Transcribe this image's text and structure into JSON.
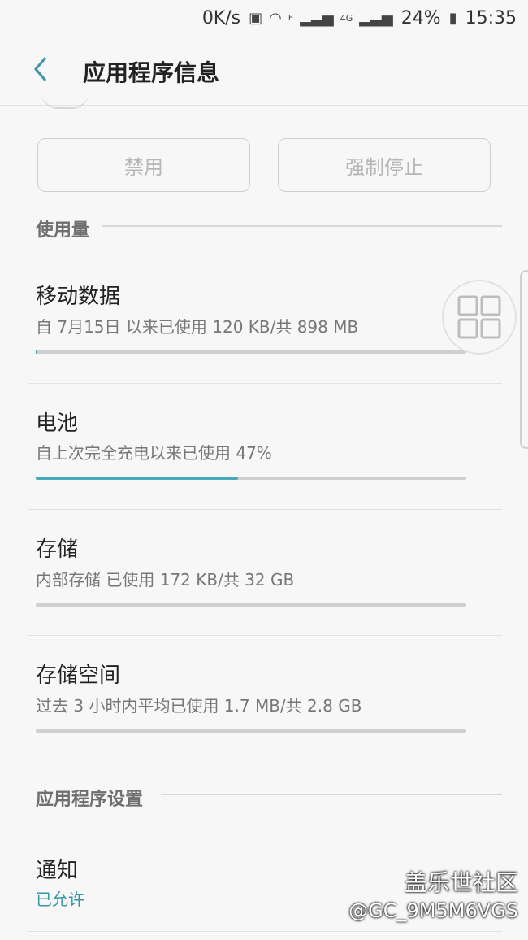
{
  "status_bar": {
    "speed": "0K/s",
    "network": "4G",
    "network_small": "E",
    "battery": "24%",
    "time": "15:35"
  },
  "header": {
    "title": "应用程序信息"
  },
  "buttons": {
    "disable": "禁用",
    "force_stop": "强制停止"
  },
  "sections": {
    "usage": "使用量",
    "app_settings": "应用程序设置"
  },
  "rows": {
    "mobile_data": {
      "title": "移动数据",
      "subtitle": "自 7月15日 以来已使用 120 KB/共 898 MB",
      "progress": 0.001
    },
    "battery": {
      "title": "电池",
      "subtitle": "自上次完全充电以来已使用 47%",
      "progress": 0.47
    },
    "storage": {
      "title": "存储",
      "subtitle": "内部存储 已使用 172 KB/共 32 GB",
      "progress": 0.0
    },
    "memory": {
      "title": "存储空间",
      "subtitle": "过去 3 小时内平均已使用 1.7 MB/共 2.8 GB",
      "progress": 0.0
    },
    "notifications": {
      "title": "通知",
      "status": "已允许"
    }
  },
  "watermark": {
    "line1": "盖乐世社区",
    "line2": "@GC_9M5M6VGS"
  },
  "colors": {
    "accent": "#4aa9b8",
    "track": "#cfcfcf"
  },
  "icons": [
    "back-arrow-icon",
    "battery-icon",
    "wifi-icon",
    "signal-icon",
    "multiwindow-icon"
  ]
}
